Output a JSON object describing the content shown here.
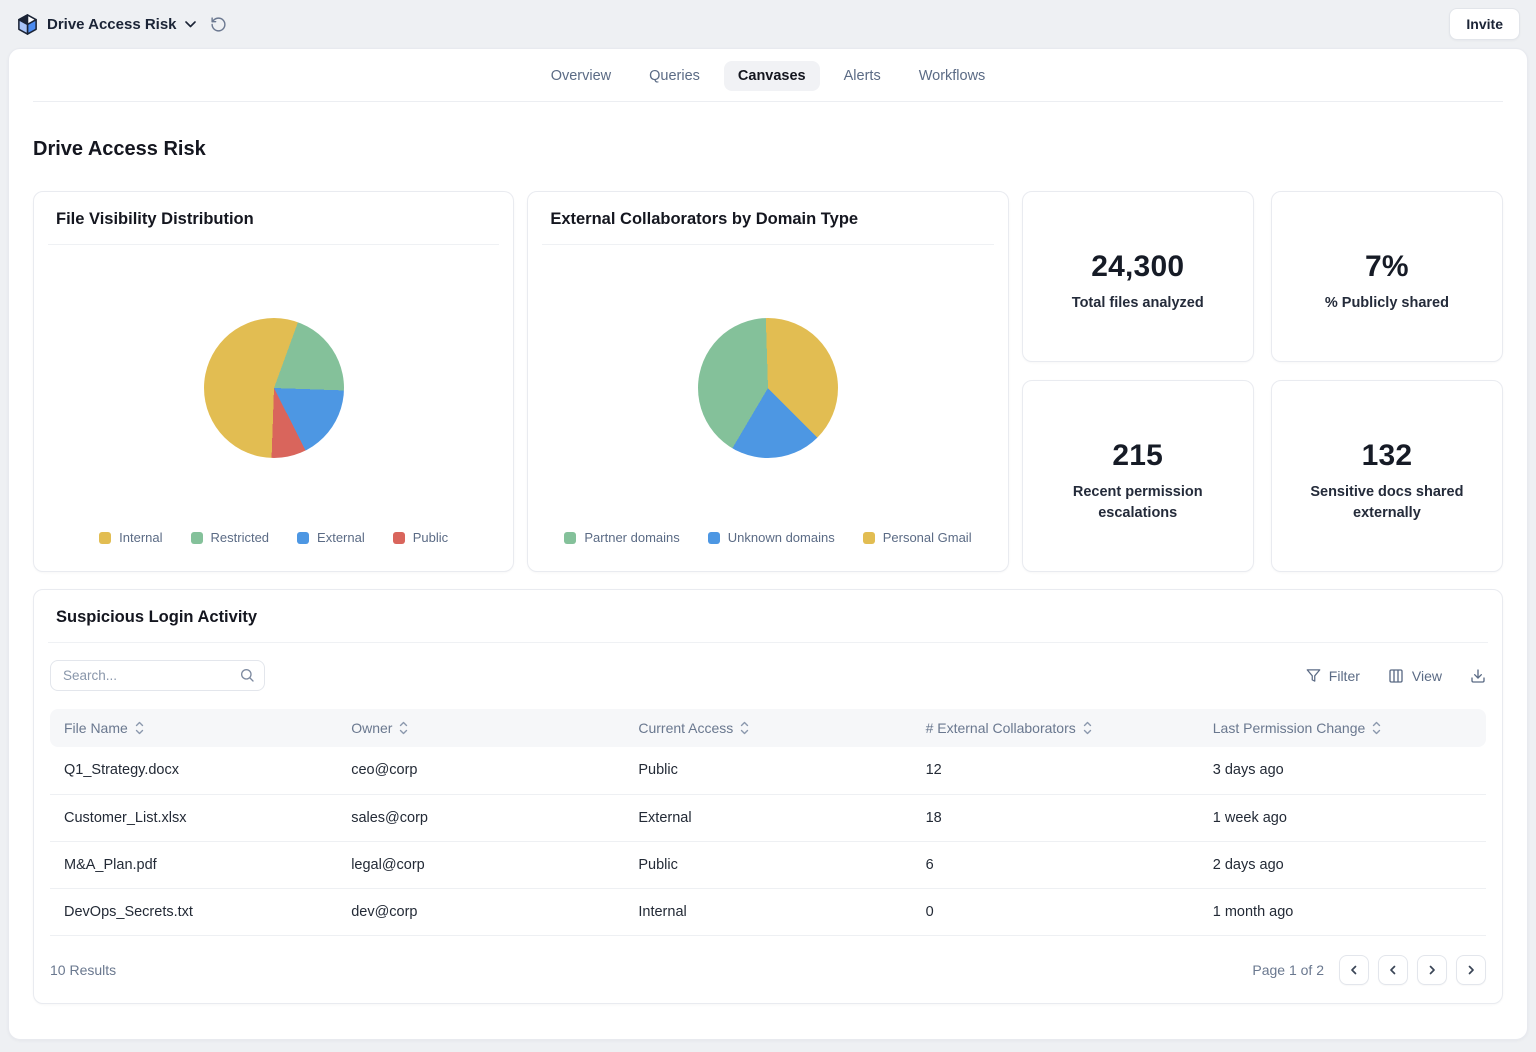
{
  "topbar": {
    "workspace_name": "Drive Access Risk",
    "invite_label": "Invite"
  },
  "tabs": [
    {
      "label": "Overview",
      "active": false
    },
    {
      "label": "Queries",
      "active": false
    },
    {
      "label": "Canvases",
      "active": true
    },
    {
      "label": "Alerts",
      "active": false
    },
    {
      "label": "Workflows",
      "active": false
    }
  ],
  "page_title": "Drive Access Risk",
  "colors": {
    "yellow": "#e2bd52",
    "green": "#84c19a",
    "blue": "#4d97e3",
    "red": "#d9655c",
    "accent_text": "#5b6b85"
  },
  "chart_data": [
    {
      "type": "pie",
      "title": "File Visibility Distribution",
      "labels": [
        "Internal",
        "Restricted",
        "External",
        "Public"
      ],
      "values": [
        55,
        20,
        17,
        8
      ],
      "colors": [
        "#e2bd52",
        "#84c19a",
        "#4d97e3",
        "#d9655c"
      ],
      "legend_position": "bottom",
      "start_deg": 182,
      "slice_order": [
        0,
        1,
        2,
        3
      ]
    },
    {
      "type": "pie",
      "title": "External Collaborators by Domain Type",
      "labels": [
        "Partner domains",
        "Unknown domains",
        "Personal Gmail"
      ],
      "values": [
        41,
        21,
        38
      ],
      "colors": [
        "#84c19a",
        "#4d97e3",
        "#e2bd52"
      ],
      "legend_position": "bottom",
      "start_deg": 135,
      "slice_order": [
        1,
        0,
        2
      ]
    }
  ],
  "stats": [
    {
      "value": "24,300",
      "label": "Total files analyzed"
    },
    {
      "value": "7%",
      "label": "% Publicly shared"
    },
    {
      "value": "215",
      "label": "Recent permission escalations"
    },
    {
      "value": "132",
      "label": "Sensitive docs shared externally"
    }
  ],
  "table": {
    "title": "Suspicious Login Activity",
    "search_placeholder": "Search...",
    "toolbar": {
      "filter_label": "Filter",
      "view_label": "View"
    },
    "columns": [
      "File Name",
      "Owner",
      "Current Access",
      "# External Collaborators",
      "Last Permission Change"
    ],
    "rows": [
      [
        "Q1_Strategy.docx",
        "ceo@corp",
        "Public",
        "12",
        "3 days ago"
      ],
      [
        "Customer_List.xlsx",
        "sales@corp",
        "External",
        "18",
        "1 week ago"
      ],
      [
        "M&A_Plan.pdf",
        "legal@corp",
        "Public",
        "6",
        "2 days ago"
      ],
      [
        "DevOps_Secrets.txt",
        "dev@corp",
        "Internal",
        "0",
        "1 month ago"
      ]
    ],
    "results_text": "10 Results",
    "pagination": {
      "page_text": "Page 1 of 2",
      "buttons": [
        {
          "name": "first",
          "dir": "left"
        },
        {
          "name": "prev",
          "dir": "left"
        },
        {
          "name": "next",
          "dir": "right"
        },
        {
          "name": "last",
          "dir": "right"
        }
      ]
    }
  }
}
